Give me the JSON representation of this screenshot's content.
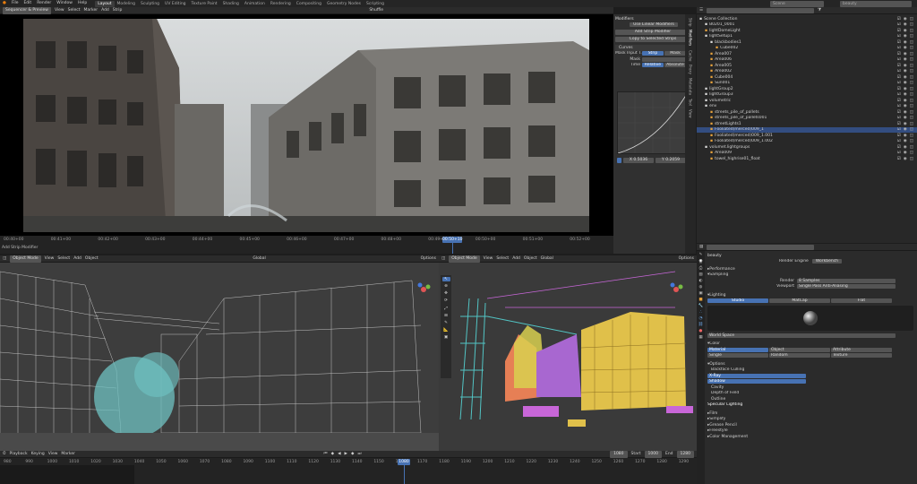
{
  "topbar": {
    "menus": [
      "File",
      "Edit",
      "Render",
      "Window",
      "Help"
    ],
    "workspaces": [
      "Layout",
      "Modeling",
      "Sculpting",
      "UV Editing",
      "Texture Paint",
      "Shading",
      "Animation",
      "Rendering",
      "Compositing",
      "Geometry Nodes",
      "Scripting"
    ],
    "active_workspace": "Layout",
    "scene": "Scene",
    "view_layer": "beauty"
  },
  "sequencer": {
    "mode": "Sequencer & Preview",
    "menus": [
      "View",
      "Select",
      "Marker",
      "Add",
      "Strip"
    ],
    "proxy": "Shuffle",
    "timecodes": [
      "00:40+00",
      "00:41+00",
      "00:42+00",
      "00:43+00",
      "00:44+00",
      "00:45+00",
      "00:46+00",
      "00:47+00",
      "00:48+00",
      "00:49+00",
      "00:50+00",
      "00:51+00",
      "00:52+00"
    ],
    "current_timecode": "00:50+10",
    "strip_label": "Add Strip Modifier"
  },
  "modifiers": {
    "title": "Modifiers",
    "use_linear": "Use Linear Modifiers",
    "add_button": "Add Strip Modifier",
    "copy_button": "Copy to Selected Strips",
    "curves_name": "Curves",
    "mask_input": "Mask Input T...",
    "mask_strip": "Strip",
    "mask_mask": "Mask",
    "mask_label": "Mask",
    "time_label": "Time",
    "time_relative": "Relative",
    "time_absolute": "Absolute",
    "curve_x": "X 0.5036",
    "curve_y": "Y 0.2059",
    "side_tabs": [
      "Strip",
      "Modifiers",
      "Cache",
      "Proxy",
      "Metadata",
      "Tool",
      "View"
    ]
  },
  "outliner": {
    "search": "",
    "items": [
      {
        "label": "Scene Collection",
        "indent": 0,
        "icon": "#ddd"
      },
      {
        "label": "B0201_0001",
        "indent": 1,
        "icon": "#ddd"
      },
      {
        "label": "lightDomeLight",
        "indent": 1,
        "icon": "#e8a33c"
      },
      {
        "label": "lightSetup1",
        "indent": 1,
        "icon": "#ddd"
      },
      {
        "label": "blackbodies1",
        "indent": 2,
        "icon": "#ddd"
      },
      {
        "label": "Cube002",
        "indent": 3,
        "icon": "#e8a33c"
      },
      {
        "label": "Area007",
        "indent": 2,
        "icon": "#e8a33c"
      },
      {
        "label": "Area006",
        "indent": 2,
        "icon": "#e8a33c"
      },
      {
        "label": "Area005",
        "indent": 2,
        "icon": "#e8a33c"
      },
      {
        "label": "Area002",
        "indent": 2,
        "icon": "#e8a33c"
      },
      {
        "label": "Cube004",
        "indent": 2,
        "icon": "#e8a33c"
      },
      {
        "label": "Sun001",
        "indent": 2,
        "icon": "#e8a33c"
      },
      {
        "label": "lightGroup2",
        "indent": 1,
        "icon": "#ddd"
      },
      {
        "label": "lightGroup3",
        "indent": 1,
        "icon": "#ddd"
      },
      {
        "label": "volumetric",
        "indent": 1,
        "icon": "#ddd"
      },
      {
        "label": "env",
        "indent": 1,
        "icon": "#ddd"
      },
      {
        "label": "streets_pile_of_pallets",
        "indent": 2,
        "icon": "#e8a33c"
      },
      {
        "label": "streets_pile_of_pallets001",
        "indent": 2,
        "icon": "#e8a33c"
      },
      {
        "label": "streetLights1",
        "indent": 2,
        "icon": "#e8a33c"
      },
      {
        "label": "Fooliated(merced)009_1",
        "indent": 2,
        "icon": "#e8a33c"
      },
      {
        "label": "Fooliated(merced)009_1.001",
        "indent": 2,
        "icon": "#e8a33c"
      },
      {
        "label": "Fooliated(merced)009_1.002",
        "indent": 2,
        "icon": "#e8a33c"
      },
      {
        "label": "volumet.lightgroups",
        "indent": 1,
        "icon": "#ddd"
      },
      {
        "label": "Area009",
        "indent": 2,
        "icon": "#e8a33c"
      },
      {
        "label": "towel_highrise01_float",
        "indent": 2,
        "icon": "#e8a33c"
      }
    ],
    "selected_index": 19
  },
  "properties": {
    "scene": "beauty",
    "render_engine_label": "Render Engine",
    "render_engine": "Workbench",
    "performance": "Performance",
    "sampling": "Sampling",
    "render_label": "Render",
    "render_value": "8 Samples",
    "viewport_label": "Viewport",
    "viewport_value": "Single Pass Anti-Aliasing",
    "lighting": "Lighting",
    "lighting_opts": [
      "Studio",
      "MatCap",
      "Flat"
    ],
    "world_space": "World Space",
    "color": "Color",
    "color_opts": [
      "Material",
      "Object",
      "Attribute",
      "Single",
      "Random",
      "Texture"
    ],
    "options": "Options",
    "backface": "Backface Culling",
    "xray": "X-Ray",
    "shadow": "Shadow",
    "cavity": "Cavity",
    "dof": "Depth of Field",
    "outline": "Outline",
    "specular": "Specular Lighting",
    "film": "Film",
    "simplify": "Simplify",
    "grease_pencil": "Grease Pencil",
    "freestyle": "Freestyle",
    "color_mgmt": "Color Management"
  },
  "viewport_left": {
    "mode": "Object Mode",
    "menus": [
      "View",
      "Select",
      "Add",
      "Object"
    ],
    "transform": "Global",
    "options": "Options"
  },
  "viewport_right": {
    "mode": "Object Mode",
    "menus": [
      "View",
      "Select",
      "Add",
      "Object"
    ],
    "transform": "Global",
    "options": "Options"
  },
  "timeline": {
    "menus": [
      "Playback",
      "Keying",
      "View",
      "Marker"
    ],
    "current_frame": "1080",
    "start_label": "Start",
    "start": "1000",
    "end_label": "End",
    "end": "1280",
    "frames": [
      "980",
      "990",
      "1000",
      "1010",
      "1020",
      "1030",
      "1040",
      "1050",
      "1060",
      "1070",
      "1080",
      "1090",
      "1100",
      "1110",
      "1120",
      "1130",
      "1140",
      "1150",
      "1160",
      "1170",
      "1180",
      "1190",
      "1200",
      "1210",
      "1220",
      "1230",
      "1240",
      "1250",
      "1260",
      "1270",
      "1280",
      "1290"
    ]
  }
}
